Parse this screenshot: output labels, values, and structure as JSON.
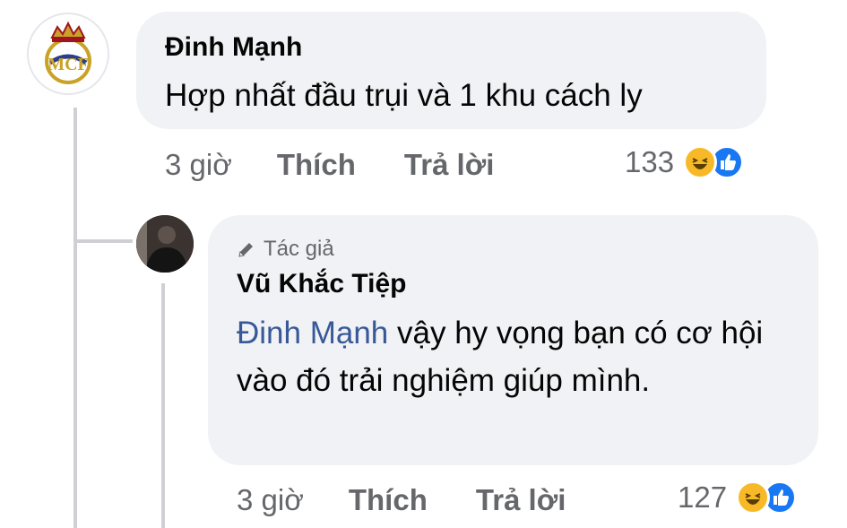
{
  "comment": {
    "author": "Đinh Mạnh",
    "text": "Hợp nhất đầu trụi và 1 khu cách ly",
    "time": "3 giờ",
    "like_label": "Thích",
    "reply_label": "Trả lời",
    "reaction_count": "133",
    "reactions": [
      "haha-icon",
      "like-icon"
    ]
  },
  "reply": {
    "badge_label": "Tác giả",
    "author": "Vũ Khắc Tiệp",
    "mention": "Đinh Mạnh",
    "text": "vậy hy vọng bạn có cơ hội vào đó trải nghiệm giúp mình.",
    "time": "3 giờ",
    "like_label": "Thích",
    "reply_label": "Trả lời",
    "reaction_count": "127",
    "reactions": [
      "haha-icon",
      "like-icon"
    ]
  },
  "colors": {
    "bubble": "#f0f2f5",
    "mention": "#385898",
    "meta": "#65676b",
    "like_blue": "#1877f2",
    "haha_yellow": "#f7b928",
    "thread_line": "#ced0d4"
  }
}
